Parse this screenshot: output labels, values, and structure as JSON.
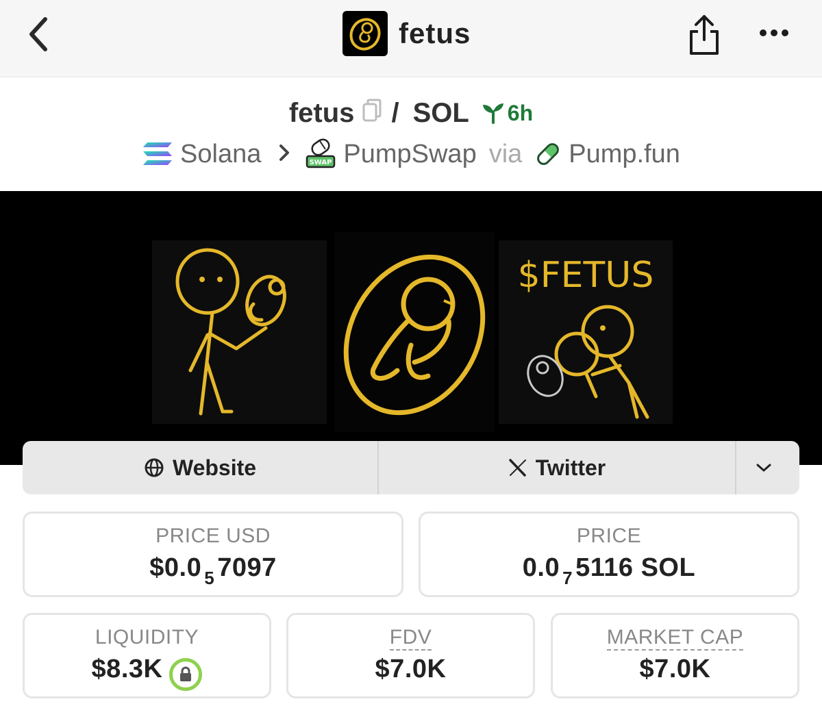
{
  "header": {
    "title": "fetus",
    "back_icon": "chevron-left-icon",
    "share_icon": "share-icon",
    "more_icon": "more-icon"
  },
  "pair": {
    "base": "fetus",
    "quote": "SOL",
    "separator": "/",
    "age": "6h"
  },
  "route": {
    "chain": "Solana",
    "dex": "PumpSwap",
    "via_label": "via",
    "launchpad": "Pump.fun"
  },
  "banner": {
    "ticker_text": "$FETUS"
  },
  "links": {
    "website_label": "Website",
    "twitter_label": "Twitter"
  },
  "stats": {
    "price_usd": {
      "label": "PRICE USD",
      "prefix": "$0.0",
      "zeros": "5",
      "digits": "7097"
    },
    "price_native": {
      "label": "PRICE",
      "prefix": "0.0",
      "zeros": "7",
      "digits": "5116 SOL"
    },
    "liquidity": {
      "label": "LIQUIDITY",
      "value": "$8.3K"
    },
    "fdv": {
      "label": "FDV",
      "value": "$7.0K"
    },
    "market_cap": {
      "label": "MARKET CAP",
      "value": "$7.0K"
    }
  },
  "colors": {
    "accent_gold": "#e5b82a",
    "age_green": "#1f7a3a",
    "lock_green": "#8fd14f"
  }
}
